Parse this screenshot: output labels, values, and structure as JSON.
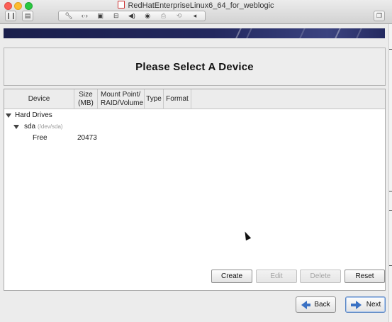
{
  "window": {
    "title": "RedHatEnterpriseLinux6_64_for_weblogic"
  },
  "toolbar": {
    "icons": [
      "wrench-icon",
      "code-brackets-icon",
      "disk-icon",
      "hard-drive-icon",
      "speaker-icon",
      "camera-icon",
      "printer-icon",
      "usb-icon",
      "chevron-left-icon"
    ]
  },
  "installer": {
    "page_title": "Please Select A Device",
    "columns": {
      "device": "Device",
      "size_line1": "Size",
      "size_line2": "(MB)",
      "mount_line1": "Mount Point/",
      "mount_line2": "RAID/Volume",
      "type": "Type",
      "format": "Format"
    },
    "tree": {
      "group_label": "Hard Drives",
      "disk_name": "sda",
      "disk_path": "(/dev/sda)",
      "free_label": "Free",
      "free_size": "20473"
    },
    "actions": {
      "create": "Create",
      "edit": "Edit",
      "delete": "Delete",
      "reset": "Reset"
    },
    "nav": {
      "back": "Back",
      "next": "Next"
    }
  },
  "colors": {
    "banner": "#1a1f4c",
    "arrow_blue": "#3b72c4"
  }
}
